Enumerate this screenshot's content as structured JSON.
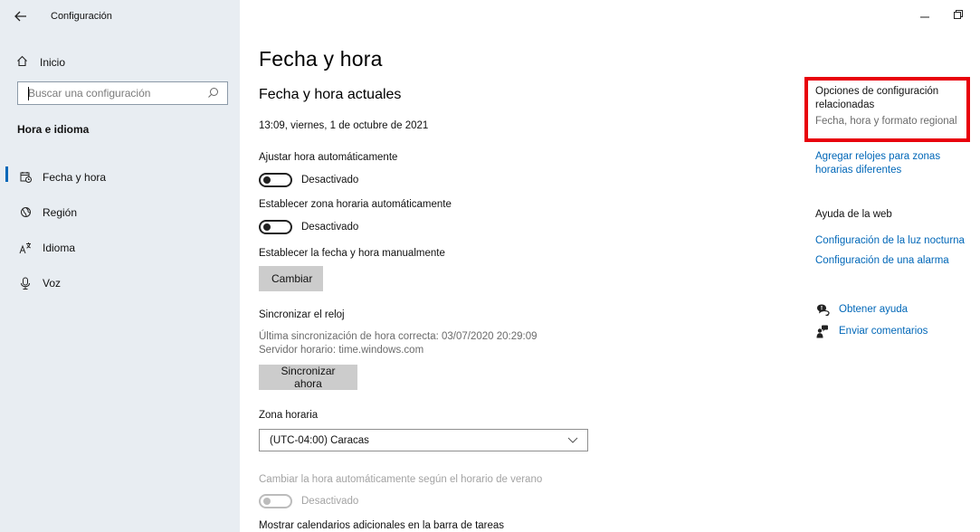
{
  "app": {
    "title": "Configuración"
  },
  "sidebar": {
    "home_label": "Inicio",
    "search_placeholder": "Buscar una configuración",
    "section_heading": "Hora e idioma",
    "items": [
      {
        "label": "Fecha y hora",
        "icon": "date-time-icon",
        "active": true
      },
      {
        "label": "Región",
        "icon": "region-icon",
        "active": false
      },
      {
        "label": "Idioma",
        "icon": "language-icon",
        "active": false
      },
      {
        "label": "Voz",
        "icon": "microphone-icon",
        "active": false
      }
    ]
  },
  "main": {
    "title": "Fecha y hora",
    "current_heading": "Fecha y hora actuales",
    "current_datetime": "13:09, viernes, 1 de octubre de 2021",
    "auto_time": {
      "label": "Ajustar hora automáticamente",
      "state": "Desactivado"
    },
    "auto_timezone": {
      "label": "Establecer zona horaria automáticamente",
      "state": "Desactivado"
    },
    "manual": {
      "label": "Establecer la fecha y hora manualmente",
      "button": "Cambiar"
    },
    "sync": {
      "heading": "Sincronizar el reloj",
      "last_sync": "Última sincronización de hora correcta: 03/07/2020 20:29:09",
      "server": "Servidor horario: time.windows.com",
      "button": "Sincronizar ahora"
    },
    "timezone": {
      "label": "Zona horaria",
      "value": "(UTC-04:00) Caracas"
    },
    "dst": {
      "label": "Cambiar la hora automáticamente según el horario de verano",
      "state": "Desactivado"
    },
    "extra_calendars_label": "Mostrar calendarios adicionales en la barra de tareas"
  },
  "related": {
    "heading": "Opciones de configuración relacionadas",
    "regional_link": "Fecha, hora y formato regional",
    "add_clocks_link": "Agregar relojes para zonas horarias diferentes",
    "web_help_heading": "Ayuda de la web",
    "night_light_link": "Configuración de la luz nocturna",
    "alarm_link": "Configuración de una alarma",
    "get_help": "Obtener ayuda",
    "feedback": "Enviar comentarios"
  },
  "colors": {
    "accent": "#0067b8",
    "highlight": "#e8000b",
    "sidebar_bg": "#e8edf2"
  }
}
